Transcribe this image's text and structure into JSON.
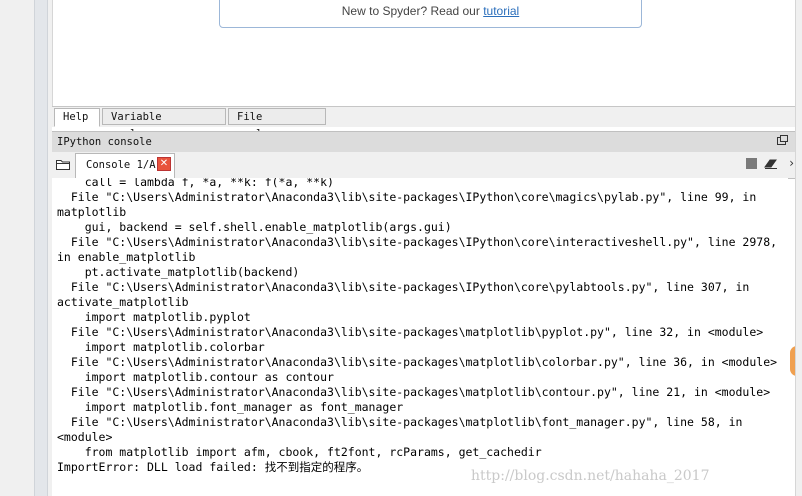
{
  "help_panel": {
    "intro_text": "New to Spyder? Read our ",
    "link_text": "tutorial"
  },
  "pane_tabs": [
    {
      "label": "Help",
      "active": true
    },
    {
      "label": "Variable explorer",
      "active": false
    },
    {
      "label": "File explorer",
      "active": false
    }
  ],
  "console_pane": {
    "title": "IPython console",
    "tab_label": "Console 1/A",
    "tab_close_glyph": "✕",
    "more_glyph": "›"
  },
  "icons": {
    "undock": "undock-icon",
    "browse": "folder-icon",
    "stop": "stop-icon",
    "clear": "eraser-icon",
    "close": "close-icon"
  },
  "colors": {
    "close_button": "#e8533c",
    "link": "#2a6ebb",
    "pane_title_bg": "#dcdcdc"
  },
  "console_lines": [
    "    call = lambda f, *a, **k: f(*a, **k)",
    "  File \"C:\\Users\\Administrator\\Anaconda3\\lib\\site-packages\\IPython\\core\\magics\\pylab.py\", line 99, in",
    "matplotlib",
    "    gui, backend = self.shell.enable_matplotlib(args.gui)",
    "  File \"C:\\Users\\Administrator\\Anaconda3\\lib\\site-packages\\IPython\\core\\interactiveshell.py\", line 2978,",
    "in enable_matplotlib",
    "    pt.activate_matplotlib(backend)",
    "  File \"C:\\Users\\Administrator\\Anaconda3\\lib\\site-packages\\IPython\\core\\pylabtools.py\", line 307, in",
    "activate_matplotlib",
    "    import matplotlib.pyplot",
    "  File \"C:\\Users\\Administrator\\Anaconda3\\lib\\site-packages\\matplotlib\\pyplot.py\", line 32, in <module>",
    "    import matplotlib.colorbar",
    "  File \"C:\\Users\\Administrator\\Anaconda3\\lib\\site-packages\\matplotlib\\colorbar.py\", line 36, in <module>",
    "    import matplotlib.contour as contour",
    "  File \"C:\\Users\\Administrator\\Anaconda3\\lib\\site-packages\\matplotlib\\contour.py\", line 21, in <module>",
    "    import matplotlib.font_manager as font_manager",
    "  File \"C:\\Users\\Administrator\\Anaconda3\\lib\\site-packages\\matplotlib\\font_manager.py\", line 58, in",
    "<module>",
    "    from matplotlib import afm, cbook, ft2font, rcParams, get_cachedir",
    "ImportError: DLL load failed: 找不到指定的程序。"
  ],
  "watermark": "http://blog.csdn.net/hahaha_2017"
}
